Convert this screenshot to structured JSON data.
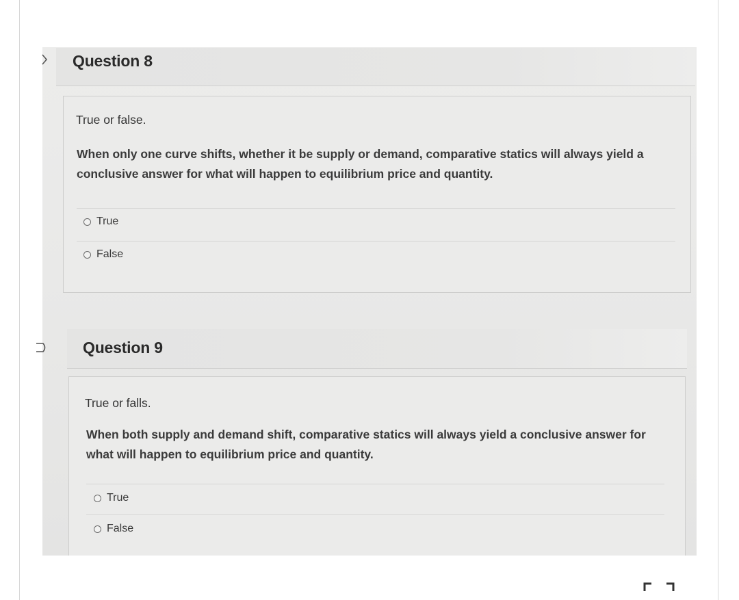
{
  "questions": [
    {
      "title": "Question 8",
      "prompt": "True or false.",
      "text_line1": "When only one curve shifts, whether it be supply or demand, comparative statics will always yield a",
      "text_line2": "conclusive answer for what will happen to equilibrium price and quantity.",
      "options": [
        {
          "label": "True"
        },
        {
          "label": "False"
        }
      ]
    },
    {
      "title": "Question 9",
      "prompt": "True or falls.",
      "text_line1": "When both supply and demand shift, comparative statics will always yield a conclusive answer for",
      "text_line2": "what will happen to equilibrium price and quantity.",
      "options": [
        {
          "label": "True"
        },
        {
          "label": "False"
        }
      ]
    }
  ],
  "icons": {
    "expand": "expand-icon",
    "q8_marker": "chevron-right-icon",
    "q9_marker": "bookmark-flag-icon"
  }
}
